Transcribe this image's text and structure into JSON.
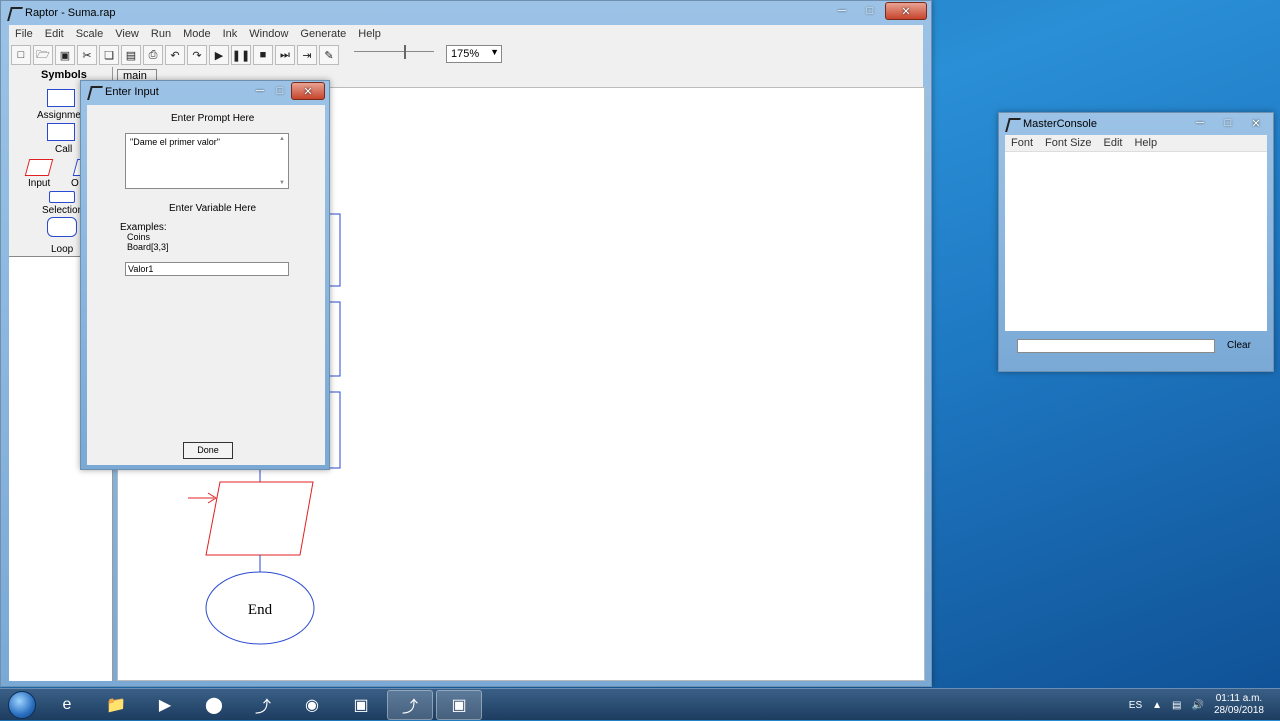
{
  "raptor": {
    "title": "Raptor - Suma.rap",
    "menu": [
      "File",
      "Edit",
      "Scale",
      "View",
      "Run",
      "Mode",
      "Ink",
      "Window",
      "Generate",
      "Help"
    ],
    "zoom": "175%",
    "symbols": {
      "title": "Symbols",
      "items": [
        "Assignment",
        "Call",
        "Input",
        "Output",
        "Selection",
        "Loop"
      ]
    },
    "tab": "main",
    "flow": {
      "end_label": "End"
    }
  },
  "dialog": {
    "title": "Enter Input",
    "prompt_label": "Enter Prompt Here",
    "prompt_value": "\"Dame el primer valor\"",
    "variable_label": "Enter Variable Here",
    "examples_title": "Examples:",
    "example_1": "Coins",
    "example_2": "Board[3,3]",
    "variable_value": "Valor1",
    "done_label": "Done"
  },
  "console": {
    "title": "MasterConsole",
    "menu": [
      "Font",
      "Font Size",
      "Edit",
      "Help"
    ],
    "clear_label": "Clear"
  },
  "taskbar": {
    "lang": "ES",
    "time": "01:11 a.m.",
    "date": "28/09/2018"
  },
  "colors": {
    "symbol_blue": "#2a4ad0",
    "input_red": "#e02020"
  }
}
